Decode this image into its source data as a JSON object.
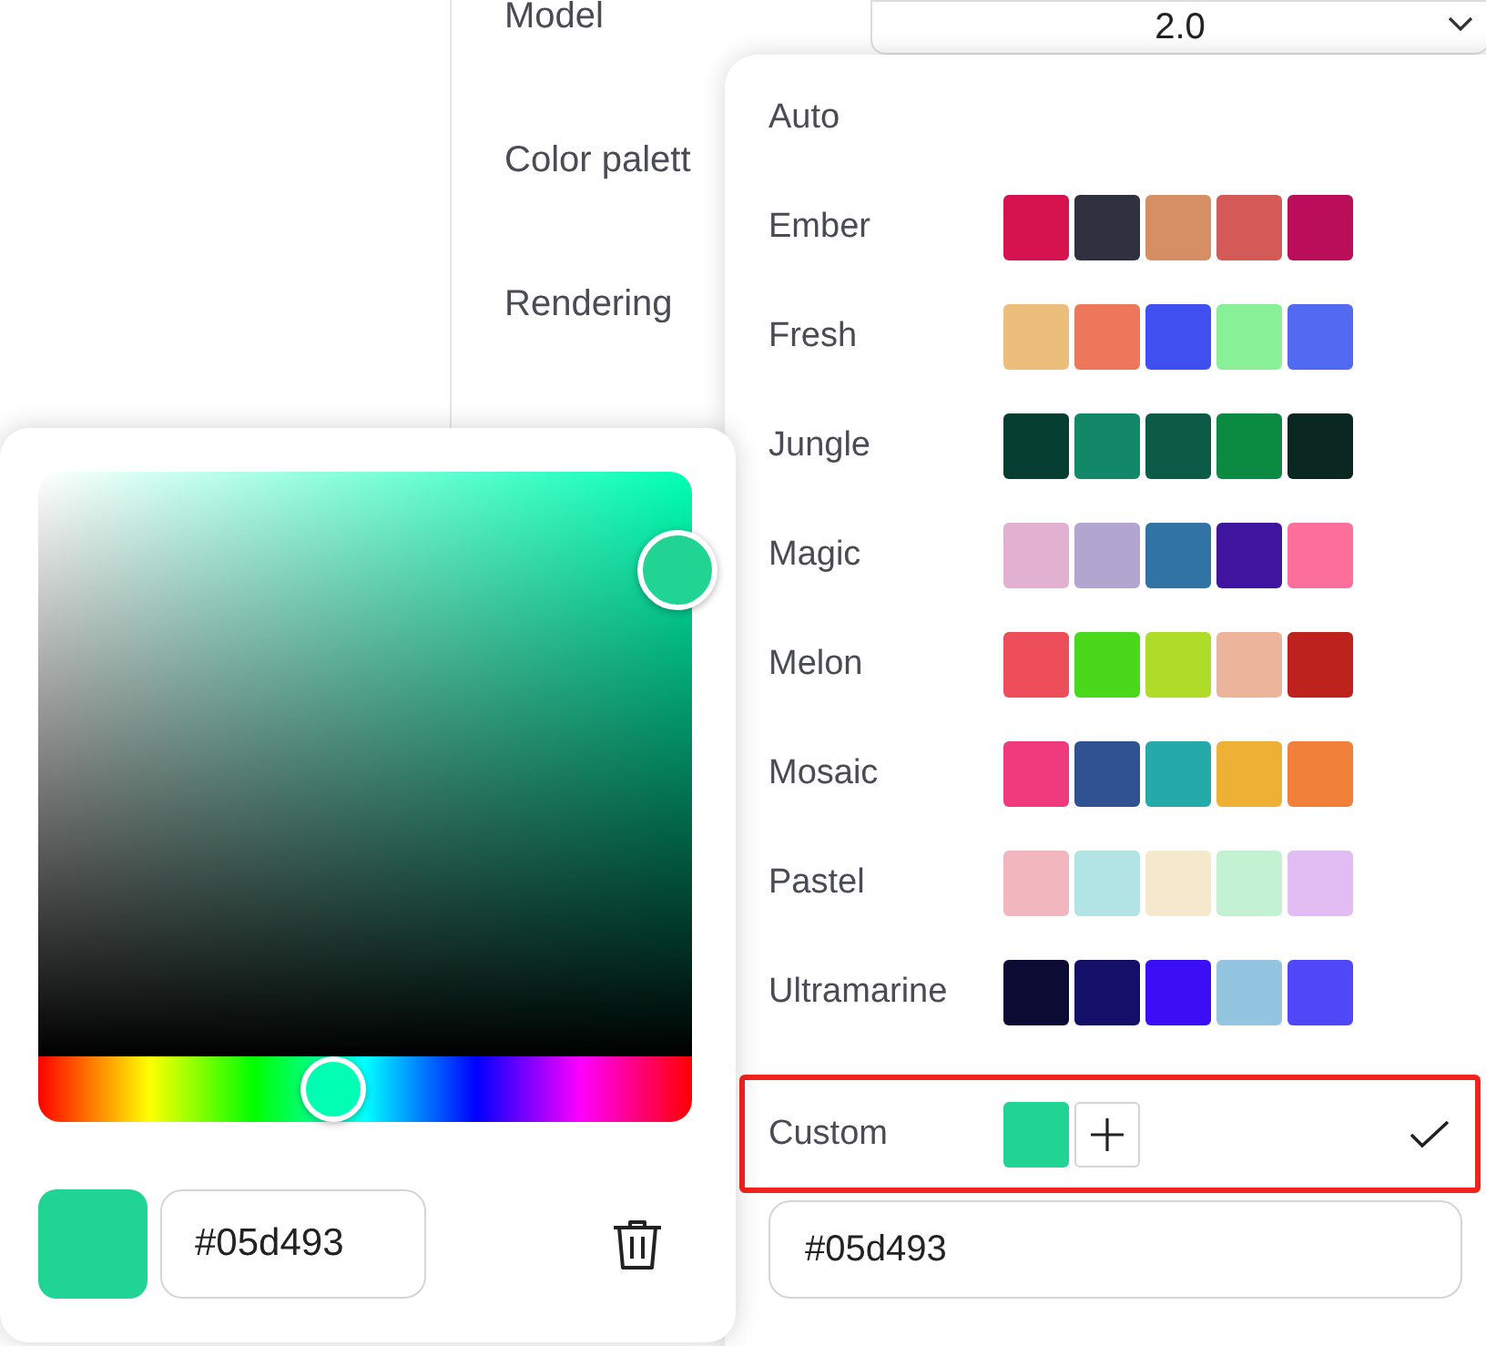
{
  "settings": {
    "rows": [
      {
        "label": "Model"
      },
      {
        "label": "Color palett"
      },
      {
        "label": "Rendering"
      }
    ],
    "model_select": {
      "value": "2.0"
    }
  },
  "palette_menu": {
    "items": [
      {
        "label": "Auto",
        "selected": false
      },
      {
        "label": "Ember",
        "selected": false,
        "swatches": [
          {
            "color": "#d6134f"
          },
          {
            "color": "#2f3140"
          },
          {
            "color": "#d68f64"
          },
          {
            "color": "#d45a58"
          },
          {
            "color": "#bb0e5a"
          }
        ]
      },
      {
        "label": "Fresh",
        "selected": false,
        "swatches": [
          {
            "color": "#ecbe7c"
          },
          {
            "color": "#ed775a"
          },
          {
            "color": "#404ff0"
          },
          {
            "color": "#88f097"
          },
          {
            "color": "#5269f1"
          }
        ]
      },
      {
        "label": "Jungle",
        "selected": false,
        "swatches": [
          {
            "color": "#063f32"
          },
          {
            "color": "#138868"
          },
          {
            "color": "#0b5b46"
          },
          {
            "color": "#0b8b42"
          },
          {
            "color": "#0a2721"
          }
        ]
      },
      {
        "label": "Magic",
        "selected": false,
        "swatches": [
          {
            "color": "#e2b0d0"
          },
          {
            "color": "#b2a6d0"
          },
          {
            "color": "#3273a6"
          },
          {
            "color": "#3f15a0"
          },
          {
            "color": "#fb6f9a"
          }
        ]
      },
      {
        "label": "Melon",
        "selected": false,
        "swatches": [
          {
            "color": "#ee4e5a"
          },
          {
            "color": "#4ad81b"
          },
          {
            "color": "#aedc28"
          },
          {
            "color": "#edb49c"
          },
          {
            "color": "#bd221c"
          }
        ]
      },
      {
        "label": "Mosaic",
        "selected": false,
        "swatches": [
          {
            "color": "#ef3a7d"
          },
          {
            "color": "#315290"
          },
          {
            "color": "#25a9a9"
          },
          {
            "color": "#efb036"
          },
          {
            "color": "#f0803a"
          }
        ]
      },
      {
        "label": "Pastel",
        "selected": false,
        "swatches": [
          {
            "color": "#f2b6bf"
          },
          {
            "color": "#b2e3e5"
          },
          {
            "color": "#f5e8cd"
          },
          {
            "color": "#c3f2d2"
          },
          {
            "color": "#e1bdf3"
          }
        ]
      },
      {
        "label": "Ultramarine",
        "selected": false,
        "swatches": [
          {
            "color": "#0c0b33"
          },
          {
            "color": "#14106a"
          },
          {
            "color": "#3b0ef5"
          },
          {
            "color": "#93c5e1"
          },
          {
            "color": "#4e48f9"
          }
        ]
      }
    ],
    "custom": {
      "label": "Custom",
      "selected": true,
      "highlighted": true,
      "swatches": [
        {
          "color": "#21d493"
        }
      ],
      "hex_value": "#05d493"
    }
  },
  "color_picker": {
    "hue": {
      "level": 0.45
    },
    "hex_value": "#05d493",
    "preview": {
      "color": "#21d493"
    }
  }
}
